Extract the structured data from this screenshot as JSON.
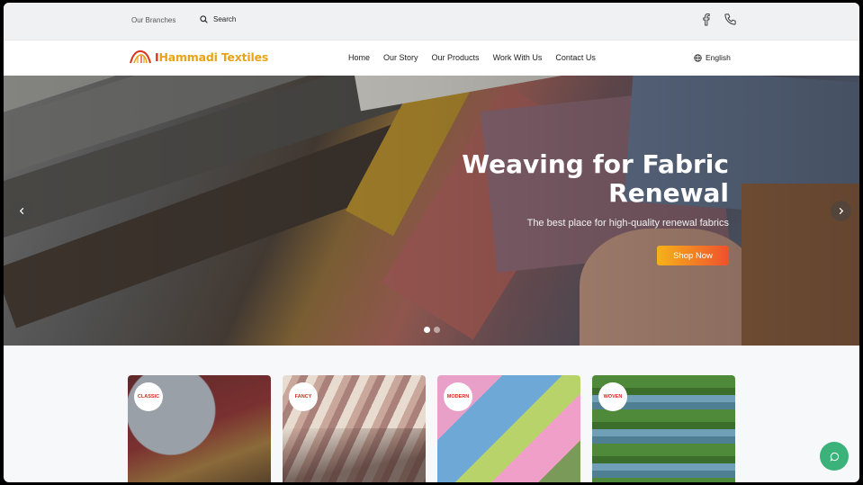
{
  "topbar": {
    "branches_label": "Our Branches",
    "search_label": "Search",
    "social_icons": [
      "facebook-icon",
      "phone-icon"
    ]
  },
  "brand": {
    "name_prefix": "I",
    "name_rest": "Hammadi Textiles",
    "colors": {
      "primary": "#e8a317",
      "accent": "#d9341f"
    }
  },
  "nav": {
    "items": [
      {
        "label": "Home"
      },
      {
        "label": "Our Story"
      },
      {
        "label": "Our Products"
      },
      {
        "label": "Work With Us"
      },
      {
        "label": "Contact Us"
      }
    ],
    "language": "English"
  },
  "hero": {
    "title_line1": "Weaving for Fabric",
    "title_line2": "Renewal",
    "subtitle": "The best place for high-quality renewal fabrics",
    "cta_label": "Shop Now",
    "slide_count": 2,
    "active_slide": 1
  },
  "categories": [
    {
      "label": "CLASSIC"
    },
    {
      "label": "FANCY"
    },
    {
      "label": "MODERN"
    },
    {
      "label": "WOVEN"
    }
  ],
  "colors": {
    "cta_gradient_start": "#f5b21a",
    "cta_gradient_end": "#f0502d",
    "chat_button": "#3bb27a",
    "badge_text": "#d42a1f"
  }
}
